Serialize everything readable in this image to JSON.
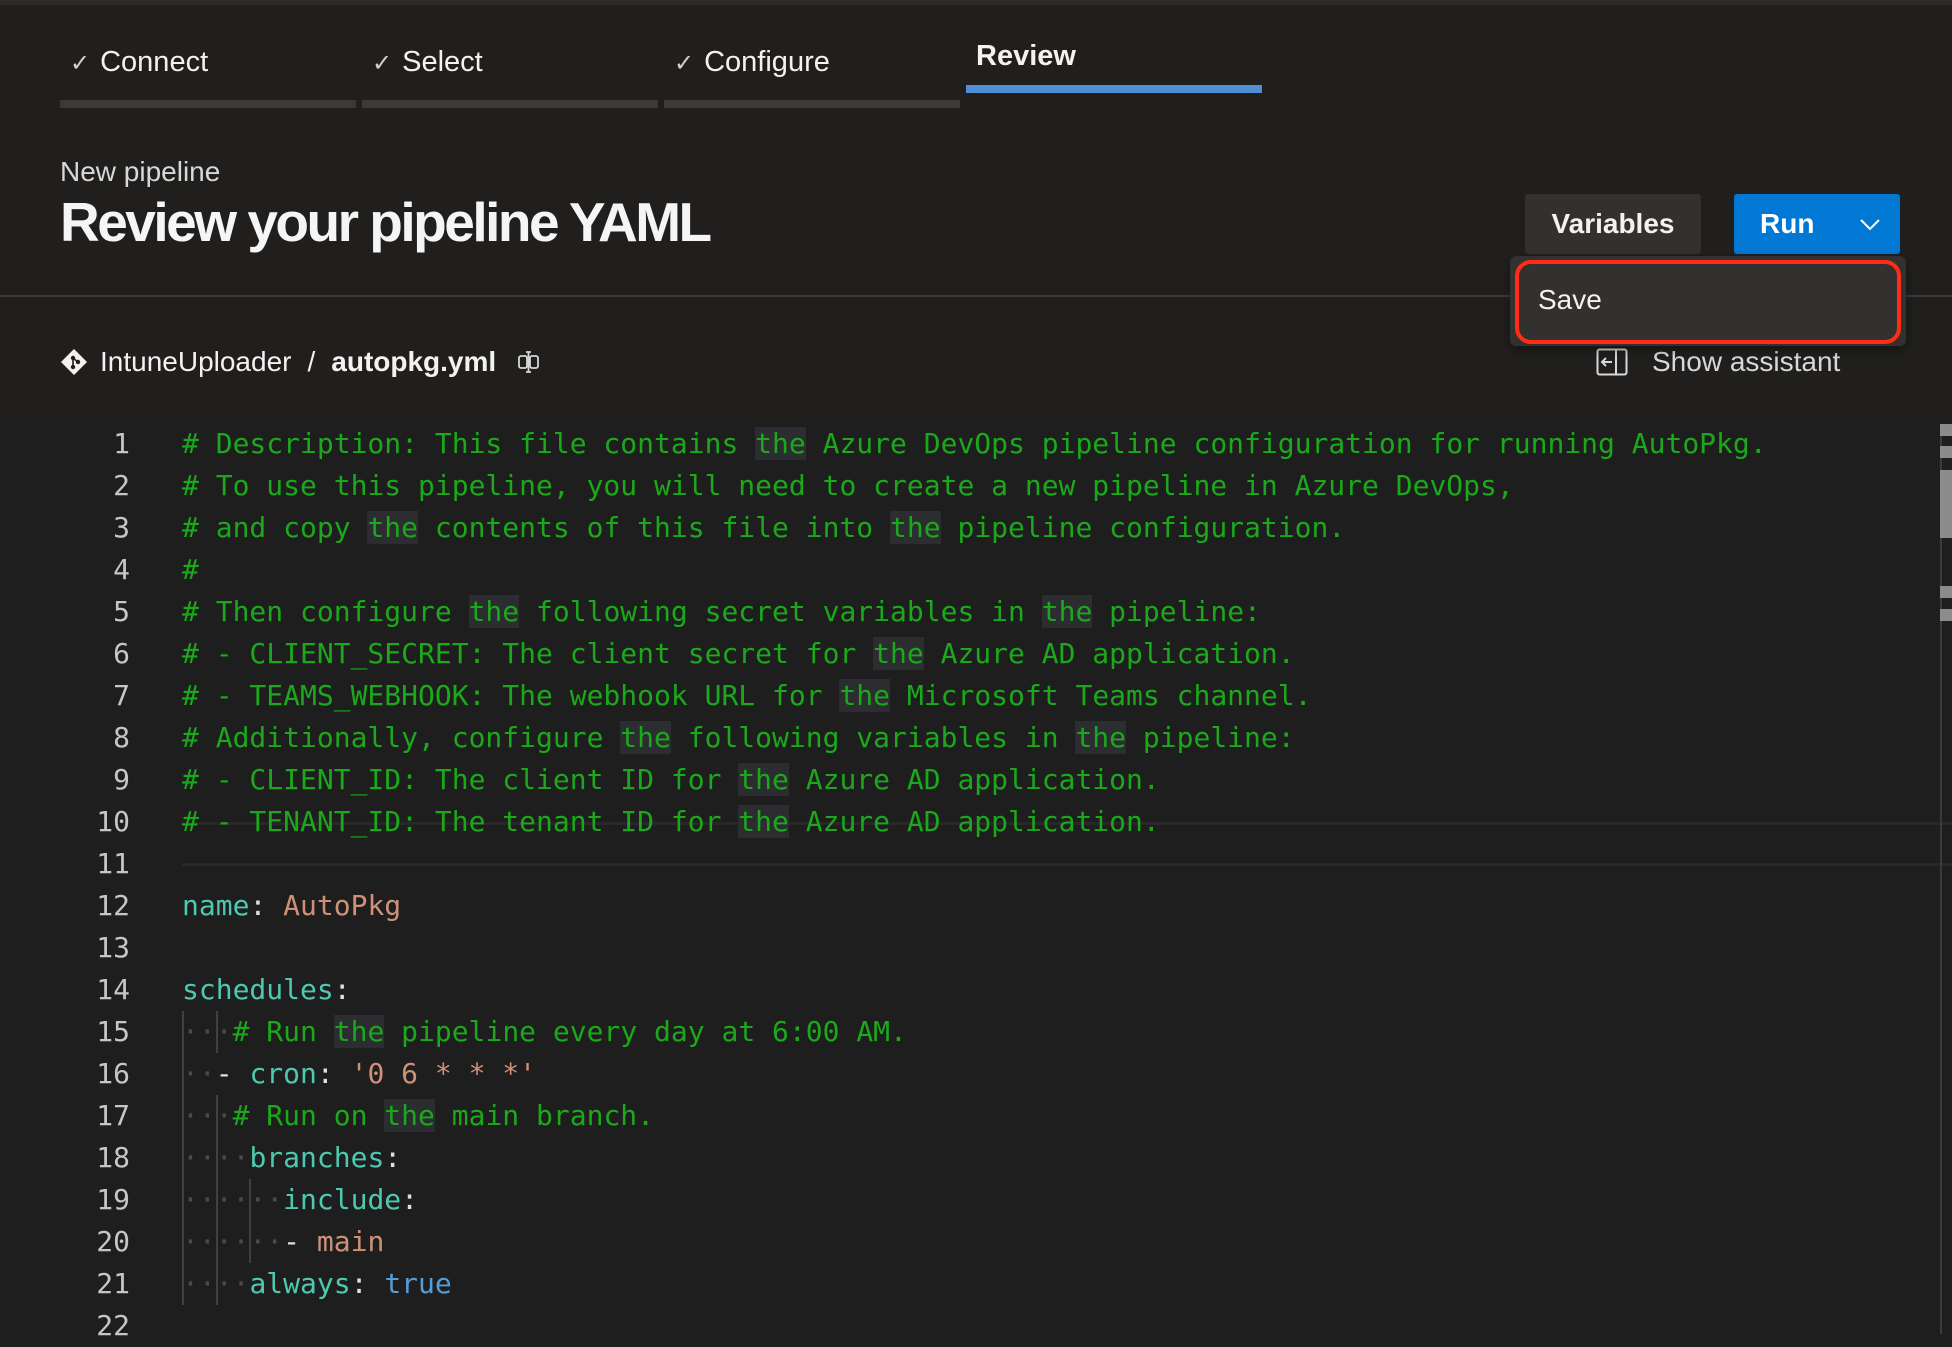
{
  "wizard": {
    "tabs": [
      {
        "label": "Connect",
        "state": "completed",
        "icon": "check-icon"
      },
      {
        "label": "Select",
        "state": "completed",
        "icon": "check-icon"
      },
      {
        "label": "Configure",
        "state": "completed",
        "icon": "check-icon"
      },
      {
        "label": "Review",
        "state": "active"
      }
    ]
  },
  "header": {
    "subtitle": "New pipeline",
    "title": "Review your pipeline YAML"
  },
  "toolbar": {
    "variables_label": "Variables",
    "run_label": "Run",
    "run_dropdown_icon": "chevron-down-icon",
    "run_color": "#0078d4"
  },
  "dropdown_menu": {
    "items": [
      {
        "label": "Save",
        "highlighted": true
      }
    ],
    "highlight_color": "#ff2d12"
  },
  "breadcrumb": {
    "repo_icon": "git-repo-icon",
    "repo": "IntuneUploader",
    "separator": "/",
    "file": "autopkg.yml",
    "rename_icon": "rename-icon"
  },
  "assistant": {
    "icon": "panel-expand-icon",
    "label": "Show assistant"
  },
  "editor": {
    "current_line": 10,
    "lines": [
      {
        "n": "1",
        "tokens": [
          [
            "c",
            "# Description: This file contains "
          ],
          [
            "c hl",
            "the"
          ],
          [
            "c",
            " Azure DevOps pipeline configuration for running AutoPkg."
          ]
        ]
      },
      {
        "n": "2",
        "tokens": [
          [
            "c",
            "# To use this pipeline, you will need to create a new pipeline in Azure DevOps,"
          ]
        ]
      },
      {
        "n": "3",
        "tokens": [
          [
            "c",
            "# and copy "
          ],
          [
            "c hl",
            "the"
          ],
          [
            "c",
            " contents of this file into "
          ],
          [
            "c hl",
            "the"
          ],
          [
            "c",
            " pipeline configuration."
          ]
        ]
      },
      {
        "n": "4",
        "tokens": [
          [
            "c",
            "#"
          ]
        ]
      },
      {
        "n": "5",
        "tokens": [
          [
            "c",
            "# Then configure "
          ],
          [
            "c hl",
            "the"
          ],
          [
            "c",
            " following secret variables in "
          ],
          [
            "c hl",
            "the"
          ],
          [
            "c",
            " pipeline:"
          ]
        ]
      },
      {
        "n": "6",
        "tokens": [
          [
            "c",
            "# - CLIENT_SECRET: The client secret for "
          ],
          [
            "c hl",
            "the"
          ],
          [
            "c",
            " Azure AD application."
          ]
        ]
      },
      {
        "n": "7",
        "tokens": [
          [
            "c",
            "# - TEAMS_WEBHOOK: The webhook URL for "
          ],
          [
            "c hl",
            "the"
          ],
          [
            "c",
            " Microsoft Teams channel."
          ]
        ]
      },
      {
        "n": "8",
        "tokens": [
          [
            "c",
            "# Additionally, configure "
          ],
          [
            "c hl",
            "the"
          ],
          [
            "c",
            " following variables in "
          ],
          [
            "c hl",
            "the"
          ],
          [
            "c",
            " pipeline:"
          ]
        ]
      },
      {
        "n": "9",
        "tokens": [
          [
            "c",
            "# - CLIENT_ID: The client ID for "
          ],
          [
            "c hl",
            "the"
          ],
          [
            "c",
            " Azure AD application."
          ]
        ]
      },
      {
        "n": "10",
        "tokens": [
          [
            "c",
            "# - TENANT_ID: The tenant ID for "
          ],
          [
            "c hl",
            "the"
          ],
          [
            "c",
            " Azure AD application."
          ]
        ]
      },
      {
        "n": "11",
        "tokens": []
      },
      {
        "n": "12",
        "tokens": [
          [
            "k",
            "name"
          ],
          [
            "p",
            ": "
          ],
          [
            "s",
            "AutoPkg"
          ]
        ]
      },
      {
        "n": "13",
        "tokens": []
      },
      {
        "n": "14",
        "tokens": [
          [
            "k",
            "schedules"
          ],
          [
            "p",
            ":"
          ]
        ]
      },
      {
        "n": "15",
        "tokens": [
          [
            "ws",
            "   "
          ],
          [
            "c",
            "# Run "
          ],
          [
            "c hl",
            "the"
          ],
          [
            "c",
            " pipeline every day at 6:00 AM."
          ]
        ]
      },
      {
        "n": "16",
        "tokens": [
          [
            "ws",
            "  "
          ],
          [
            "p",
            "- "
          ],
          [
            "k",
            "cron"
          ],
          [
            "p",
            ": "
          ],
          [
            "s",
            "'0 6 * * *'"
          ]
        ]
      },
      {
        "n": "17",
        "tokens": [
          [
            "ws",
            "   "
          ],
          [
            "c",
            "# Run on "
          ],
          [
            "c hl",
            "the"
          ],
          [
            "c",
            " main branch."
          ]
        ]
      },
      {
        "n": "18",
        "tokens": [
          [
            "ws",
            "    "
          ],
          [
            "k",
            "branches"
          ],
          [
            "p",
            ":"
          ]
        ]
      },
      {
        "n": "19",
        "tokens": [
          [
            "ws",
            "      "
          ],
          [
            "k",
            "include"
          ],
          [
            "p",
            ":"
          ]
        ]
      },
      {
        "n": "20",
        "tokens": [
          [
            "ws",
            "      "
          ],
          [
            "p",
            "- "
          ],
          [
            "s",
            "main"
          ]
        ]
      },
      {
        "n": "21",
        "tokens": [
          [
            "ws",
            "    "
          ],
          [
            "k",
            "always"
          ],
          [
            "p",
            ": "
          ],
          [
            "b",
            "true"
          ]
        ]
      },
      {
        "n": "22",
        "tokens": []
      }
    ]
  }
}
